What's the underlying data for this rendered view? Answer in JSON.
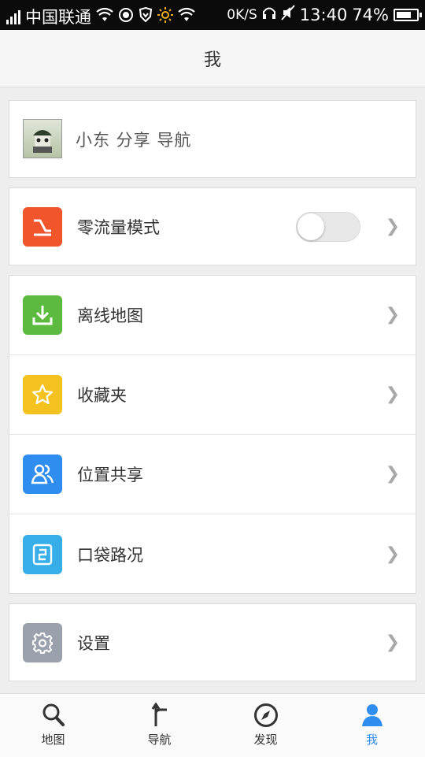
{
  "statusbar": {
    "carrier": "中国联通",
    "speed": "0K/S",
    "time": "13:40",
    "battery_percent": "74%",
    "battery_level": 0.74
  },
  "header": {
    "title": "我"
  },
  "profile": {
    "username": "小东 分享 导航"
  },
  "zero_flow": {
    "label": "零流量模式",
    "toggle_on": false,
    "icon_color": "#f0552b"
  },
  "menu": [
    {
      "label": "离线地图",
      "icon": "download-icon",
      "color": "#5cbb3e"
    },
    {
      "label": "收藏夹",
      "icon": "star-icon",
      "color": "#f3c21e"
    },
    {
      "label": "位置共享",
      "icon": "people-icon",
      "color": "#2f8df0"
    },
    {
      "label": "口袋路况",
      "icon": "route-icon",
      "color": "#38aee8"
    }
  ],
  "settings": {
    "label": "设置",
    "icon": "gear-icon",
    "color": "#9aa1ad"
  },
  "bottom_nav": [
    {
      "label": "地图",
      "icon": "search-icon",
      "active": false
    },
    {
      "label": "导航",
      "icon": "navigation-arrow-icon",
      "active": false
    },
    {
      "label": "发现",
      "icon": "compass-icon",
      "active": false
    },
    {
      "label": "我",
      "icon": "person-icon",
      "active": true
    }
  ],
  "colors": {
    "accent": "#2f8df0"
  }
}
